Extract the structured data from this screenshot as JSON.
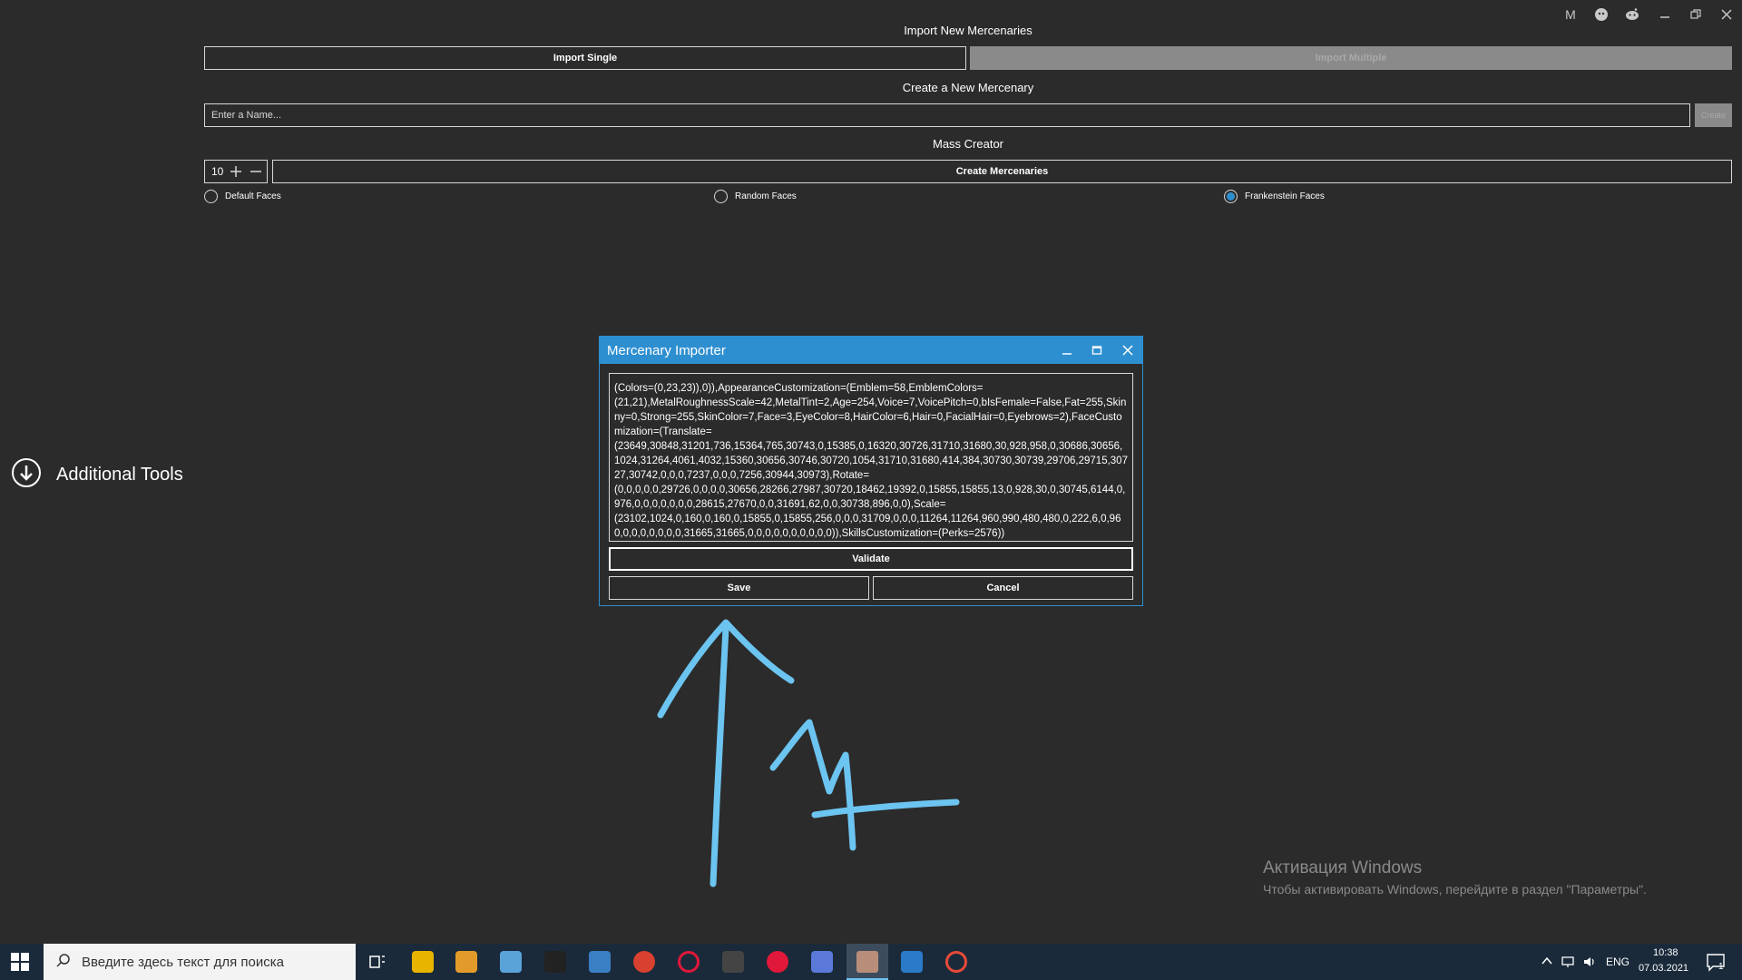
{
  "window_controls": {
    "m_label": "M"
  },
  "import_section": {
    "title": "Import New Mercenaries",
    "import_single": "Import Single",
    "import_multiple": "Import Multiple"
  },
  "create_section": {
    "title": "Create a New Mercenary",
    "name_placeholder": "Enter a Name...",
    "create_button": "Create"
  },
  "mass_section": {
    "title": "Mass Creator",
    "count": "10",
    "create_mercs": "Create Mercenaries",
    "radios": [
      {
        "label": "Default Faces",
        "checked": false
      },
      {
        "label": "Random Faces",
        "checked": false
      },
      {
        "label": "Frankenstein Faces",
        "checked": true
      }
    ]
  },
  "sidebar": {
    "additional_tools": "Additional Tools"
  },
  "dialog": {
    "title": "Mercenary Importer",
    "text_lines": [
      "(Colors=(0,23,23)),0)),AppearanceCustomization=(Emblem=58,EmblemColors=",
      "(21,21),MetalRoughnessScale=42,MetalTint=2,Age=254,Voice=7,VoicePitch=0,bIsFemale=False,Fat=255,Skinny=0,Strong=255,SkinColor=7,Face=3,EyeColor=8,HairColor=6,Hair=0,FacialHair=0,Eyebrows=2),FaceCustomization=(Translate=",
      "(23649,30848,31201,736,15364,765,30743,0,15385,0,16320,30726,31710,31680,30,928,958,0,30686,30656,1024,31264,4061,4032,15360,30656,30746,30720,1054,31710,31680,414,384,30730,30739,29706,29715,30727,30742,0,0,0,7237,0,0,0,7256,30944,30973),Rotate=",
      "(0,0,0,0,0,29726,0,0,0,0,30656,28266,27987,30720,18462,19392,0,15855,15855,13,0,928,30,0,30745,6144,0,976,0,0,0,0,0,0,0,28615,27670,0,0,31691,62,0,0,30738,896,0,0),Scale=",
      "(23102,1024,0,160,0,160,0,15855,0,15855,256,0,0,0,31709,0,0,0,11264,11264,960,990,480,480,0,222,6,0,960,0,0,0,0,0,0,0,31665,31665,0,0,0,0,0,0,0,0,0,0)),SkillsCustomization=(Perks=2576))"
    ],
    "validate": "Validate",
    "save": "Save",
    "cancel": "Cancel"
  },
  "watermark": {
    "title": "Активация Windows",
    "subtitle": "Чтобы активировать Windows, перейдите в раздел \"Параметры\"."
  },
  "taskbar": {
    "search_placeholder": "Введите здесь текст для поиска",
    "language": "ENG",
    "time": "10:38",
    "date": "07.03.2021",
    "notification_count": "1"
  },
  "colors": {
    "background": "#2b2b2b",
    "accent": "#2e8fd0",
    "annotation": "#6cc4f0"
  }
}
